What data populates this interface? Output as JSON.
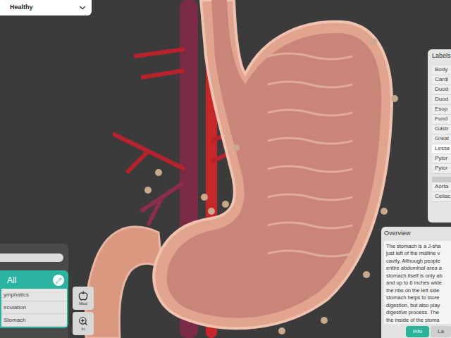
{
  "view_selector": {
    "value": "Healthy"
  },
  "labels_panel": {
    "title": "Labels",
    "groups": [
      {
        "items": [
          {
            "label": "Body",
            "selected": false
          },
          {
            "label": "Cardi",
            "selected": false
          },
          {
            "label": "Duod",
            "selected": false
          },
          {
            "label": "Duod",
            "selected": false
          },
          {
            "label": "Esop",
            "selected": false
          },
          {
            "label": "Fund",
            "selected": false
          },
          {
            "label": "Gastr",
            "selected": false
          },
          {
            "label": "Great",
            "selected": false
          },
          {
            "label": "Lesse",
            "selected": true
          },
          {
            "label": "Pylor",
            "selected": false
          },
          {
            "label": "Pylor",
            "selected": false
          }
        ]
      },
      {
        "items": [
          {
            "label": "Aorta",
            "selected": false
          },
          {
            "label": "Celiac",
            "selected": false
          }
        ]
      }
    ]
  },
  "overview": {
    "title": "Overview",
    "lines": [
      "The stomach is a J-sha",
      "just left of the midline v",
      "cavity. Although people",
      "entire abdominal area a",
      "stomach itself is only ab",
      "and up to 6 inches wide",
      "the ribs on the left side",
      "stomach helps to store",
      "digestion, but also play",
      "digestive process. The",
      "the inside of the stoma"
    ],
    "tabs": [
      {
        "label": "Info",
        "selected": true
      },
      {
        "label": "La",
        "selected": false
      }
    ]
  },
  "layers_panel": {
    "header": "All",
    "items": [
      "ymphatics",
      "irculation",
      "Stomach"
    ]
  },
  "tool_buttons": [
    {
      "label": "Mod",
      "kind": "model"
    },
    {
      "label": "In",
      "kind": "zoom"
    }
  ]
}
